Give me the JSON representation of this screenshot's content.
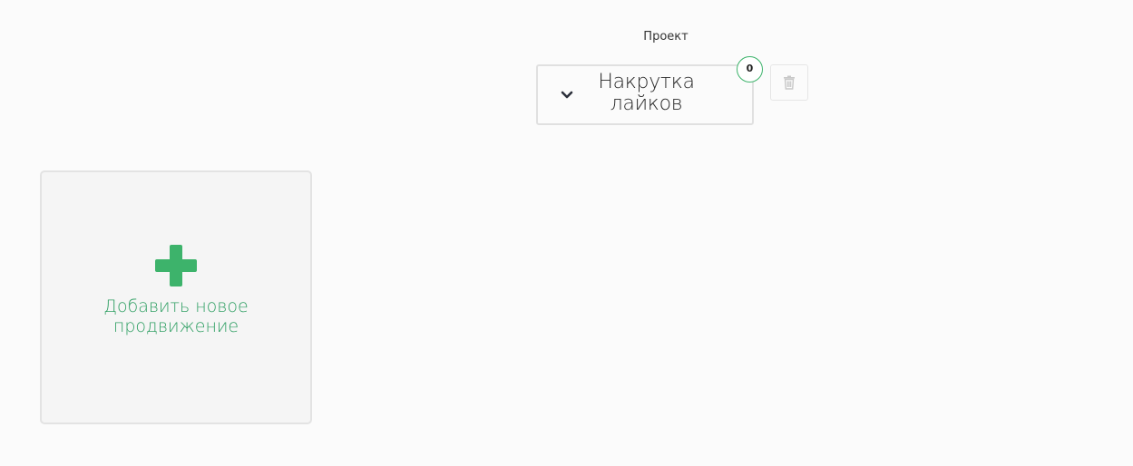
{
  "project": {
    "label": "Проект",
    "selected_value": "Накрутка лайков",
    "count": "0"
  },
  "add_promotion": {
    "label": "Добавить новое продвижение"
  },
  "icons": {
    "chevron": "chevron-down-icon",
    "trash": "trash-icon",
    "plus": "plus-icon"
  },
  "colors": {
    "accent": "#3db36b",
    "accent_text": "#2f9f63",
    "background": "#fbfbfb",
    "card_background": "#f5f5f5"
  }
}
